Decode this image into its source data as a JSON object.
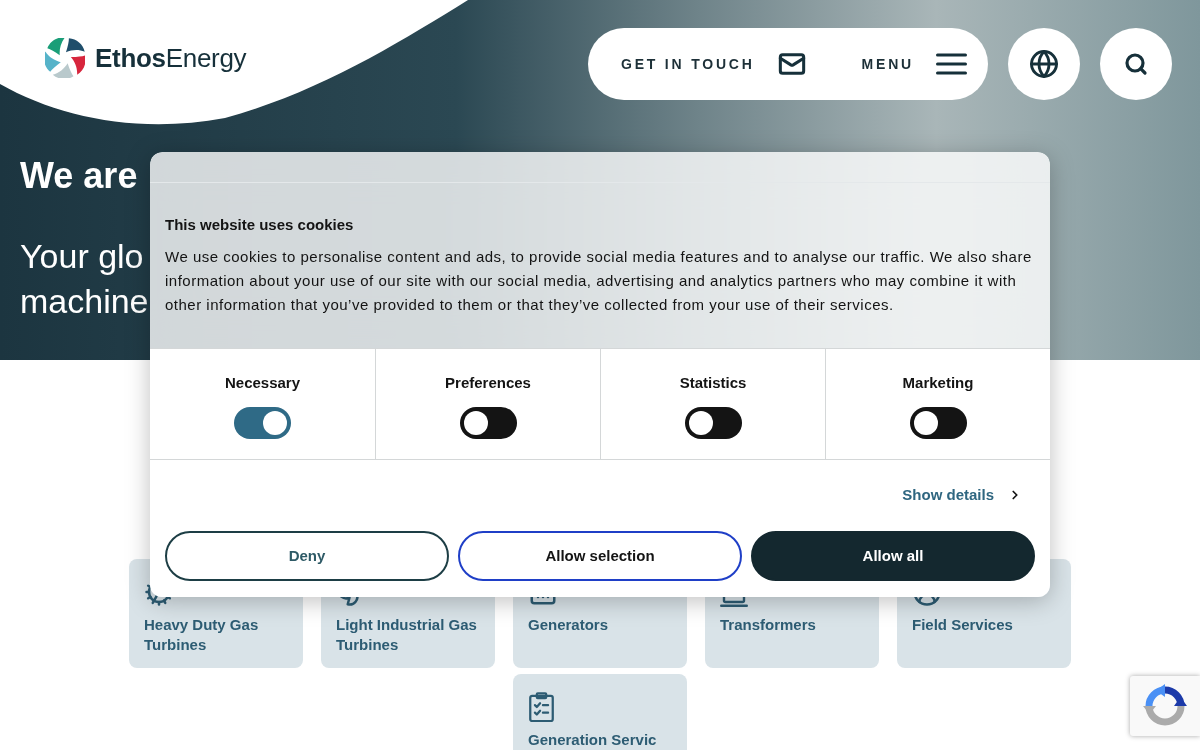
{
  "header": {
    "logo_text": "**Ethos**Energy",
    "contact_button": "GET IN TOUCH",
    "menu_button": "MENU"
  },
  "hero": {
    "heading": "We are",
    "subheading_fragments": [
      "Your glo",
      "machine"
    ]
  },
  "cookie_dialog": {
    "title": "This website uses cookies",
    "body": "We use cookies to personalise content and ads, to provide social media features and to analyse our traffic. We also share information about your use of our site with our social media, advertising and analytics partners who may combine it with other information that you’ve provided to them or that they’ve collected from your use of their services.",
    "categories": [
      {
        "label": "Necessary",
        "on": true
      },
      {
        "label": "Preferences",
        "on": false
      },
      {
        "label": "Statistics",
        "on": false
      },
      {
        "label": "Marketing",
        "on": false
      }
    ],
    "details_link": "Show details",
    "buttons": [
      {
        "label": "Deny",
        "kind": "outline"
      },
      {
        "label": "Allow selection",
        "kind": "accent"
      },
      {
        "label": "Allow all",
        "kind": "solid"
      }
    ]
  },
  "service_cards": [
    {
      "label": "Heavy Duty Gas Turbines"
    },
    {
      "label": "Light Industrial Gas Turbines"
    },
    {
      "label": "Generators"
    },
    {
      "label": "Transformers"
    },
    {
      "label": "Field Services"
    },
    {
      "label": "Generation Servic"
    }
  ]
}
